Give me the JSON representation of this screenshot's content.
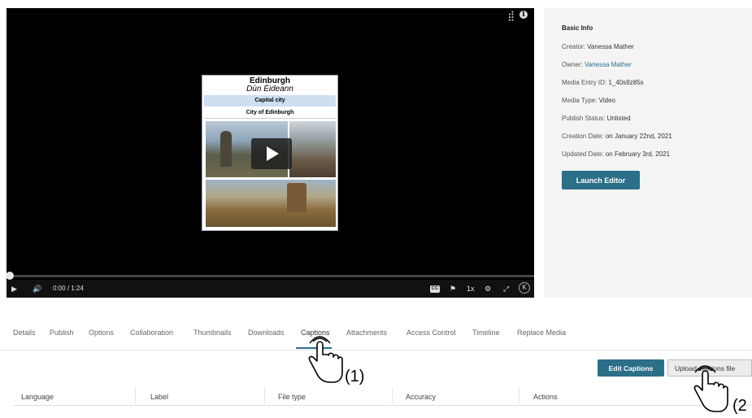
{
  "player": {
    "thumbnail": {
      "title": "Edinburgh",
      "subtitle": "Dùn Èideann",
      "band1": "Capital city",
      "band2": "City of Edinburgh"
    },
    "controls": {
      "time": "0:00",
      "duration": "/ 1:24",
      "speed": "1x",
      "cc": "CC",
      "progress_fraction": 0
    },
    "icons": [
      "share-icon",
      "info-icon",
      "play-icon",
      "volume-icon",
      "captions-icon",
      "flag-icon",
      "gear-icon",
      "expand-icon",
      "kaltura-logo-icon"
    ]
  },
  "info": {
    "heading": "Basic Info",
    "rows": [
      {
        "label": "Creator:",
        "value": "Vanessa Mather"
      },
      {
        "label": "Owner:",
        "value": "Vanessa Mather"
      },
      {
        "label": "Media Entry ID:",
        "value": "1_40s9z85s"
      },
      {
        "label": "Media Type:",
        "value": "Video"
      },
      {
        "label": "Publish Status:",
        "value": "Unlisted"
      },
      {
        "label": "Creation Date:",
        "value": "on January 22nd, 2021"
      },
      {
        "label": "Updated Date:",
        "value": "on February 3rd, 2021"
      }
    ],
    "launch_editor": "Launch Editor"
  },
  "tabs": [
    "Details",
    "Publish",
    "Options",
    "Collaboration",
    "Thumbnails",
    "Downloads",
    "Captions",
    "Attachments",
    "Access Control",
    "Timeline",
    "Replace Media"
  ],
  "active_tab": "Captions",
  "captions": {
    "edit_button": "Edit Captions",
    "upload_button": "Upload captions file",
    "columns": [
      "Language",
      "Label",
      "File type",
      "Accuracy",
      "Actions"
    ]
  },
  "annotations": {
    "callout1": "(1)",
    "callout2": "(2"
  },
  "colors": {
    "accent": "#2c6f89",
    "player_bg": "#000000",
    "panel_bg": "#f4f4f4"
  }
}
